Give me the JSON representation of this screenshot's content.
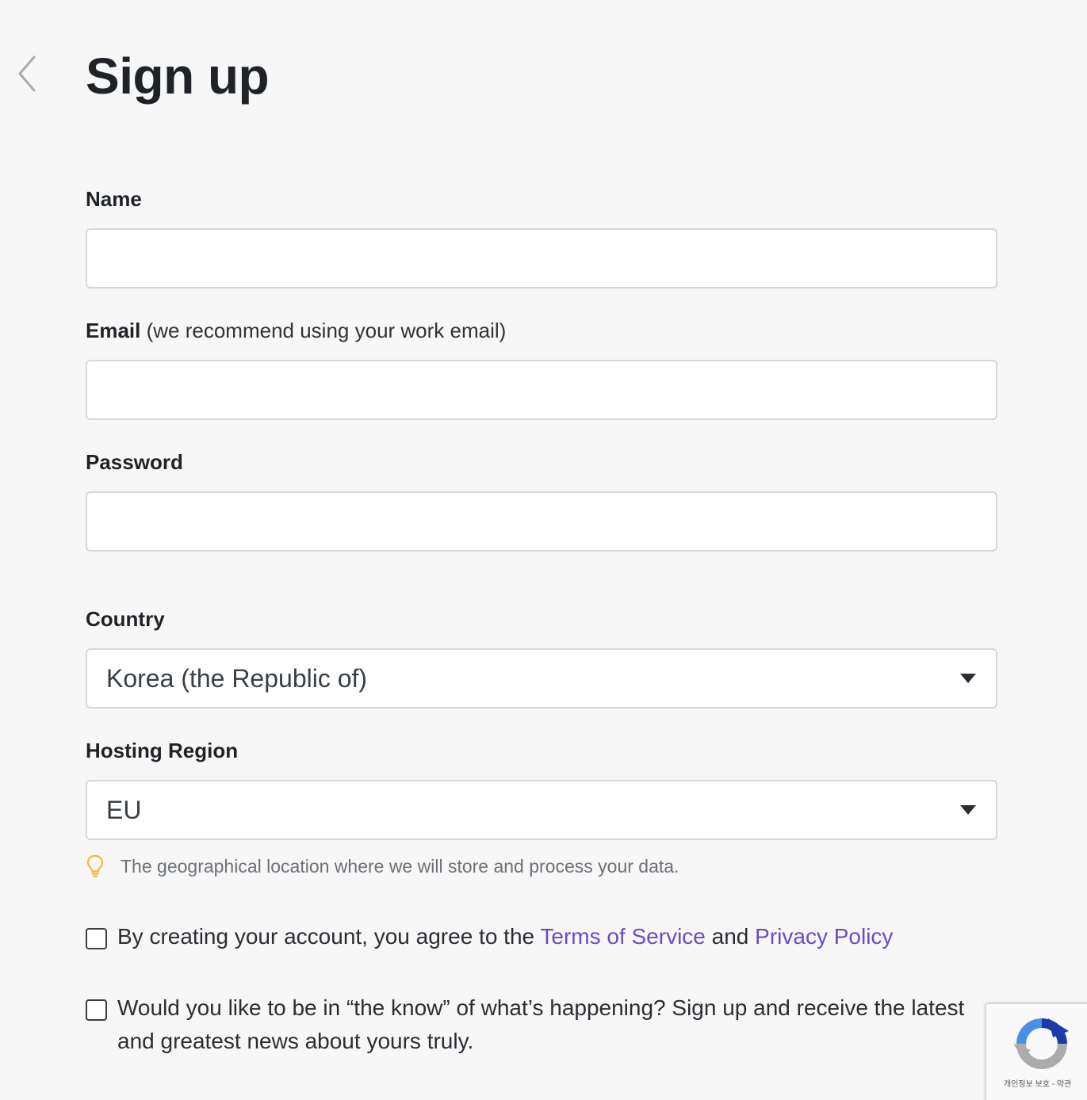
{
  "header": {
    "title": "Sign up",
    "back_icon": "chevron-left-icon"
  },
  "form": {
    "name": {
      "label": "Name",
      "value": "",
      "placeholder": ""
    },
    "email": {
      "label": "Email",
      "label_note": "(we recommend using your work email)",
      "value": "",
      "placeholder": ""
    },
    "password": {
      "label": "Password",
      "value": "",
      "placeholder": ""
    },
    "country": {
      "label": "Country",
      "selected": "Korea (the Republic of)"
    },
    "hosting_region": {
      "label": "Hosting Region",
      "selected": "EU",
      "hint": "The geographical location where we will store and process your data.",
      "hint_icon": "lightbulb-icon"
    },
    "terms": {
      "text_before": "By creating your account, you agree to the ",
      "terms_link": "Terms of Service",
      "text_middle": " and ",
      "privacy_link": "Privacy Policy",
      "checked": false
    },
    "newsletter": {
      "text": "Would you like to be in “the know” of what’s happening? Sign up and receive the latest and greatest news about yours truly.",
      "checked": false
    }
  },
  "recaptcha": {
    "terms_text": "개인정보 보호 - 약관"
  },
  "colors": {
    "background": "#f7f7f7",
    "link": "#6a4cc6",
    "border": "#d5d7da",
    "hint_icon": "#f3b73b"
  }
}
